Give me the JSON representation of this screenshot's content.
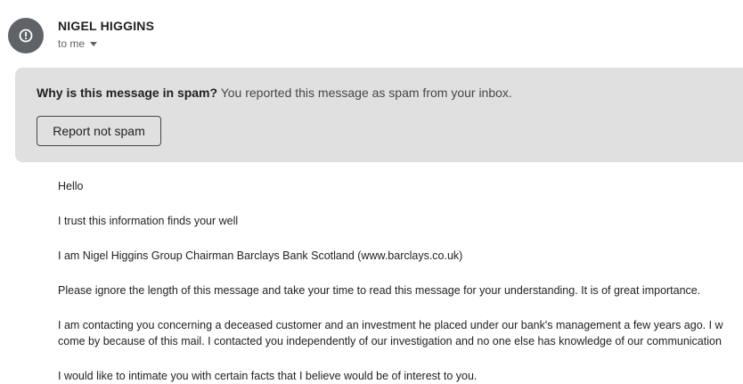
{
  "sender": {
    "avatar_icon": "alert-circle-icon",
    "name": "NIGEL HIGGINS",
    "recipient": "to me"
  },
  "spam_banner": {
    "question": "Why is this message in spam?",
    "explanation": "You reported this message as spam from your inbox.",
    "button_label": "Report not spam"
  },
  "body": {
    "p1": "Hello",
    "p2": "I trust this information finds your well",
    "p3": "I am Nigel Higgins Group Chairman Barclays Bank Scotland (www.barclays.co.uk)",
    "p4": "Please ignore the length of this message and take your time to read this message for your understanding. It is of great importance.",
    "p5_line1": "I am contacting you concerning a deceased customer and an investment he placed under our bank's management a few years ago. I w",
    "p5_line2": "come by because of this mail. I contacted you independently of our investigation and no one else has knowledge of our communication",
    "p6": "I would like to intimate you with certain facts that I believe would be of interest to you."
  }
}
